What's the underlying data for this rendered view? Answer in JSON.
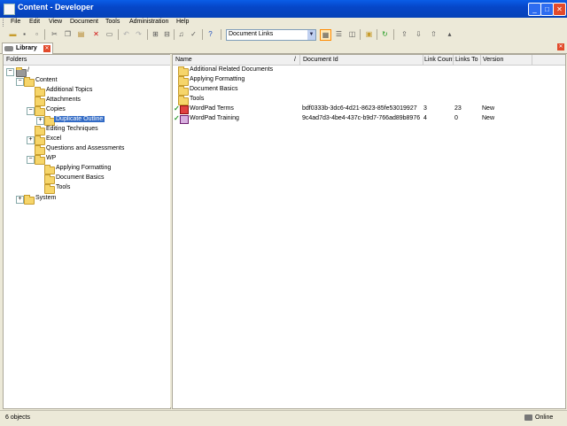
{
  "window": {
    "title": "Content - Developer"
  },
  "menu": [
    "File",
    "Edit",
    "View",
    "Document",
    "Tools",
    "Administration",
    "Help"
  ],
  "toolbar": {
    "links_combo_value": "Document Links"
  },
  "tab": {
    "label": "Library"
  },
  "folders_pane": {
    "header": "Folders",
    "tree": [
      {
        "label": "/",
        "expander": "−"
      },
      {
        "label": "Content",
        "expander": "−"
      },
      {
        "label": "Additional Topics"
      },
      {
        "label": "Attachments"
      },
      {
        "label": "Copies",
        "expander": "−"
      },
      {
        "label": "Duplicate Outline",
        "expander": "+",
        "selected": true
      },
      {
        "label": "Editing Techniques"
      },
      {
        "label": "Excel",
        "expander": "+"
      },
      {
        "label": "Questions and Assessments"
      },
      {
        "label": "WP",
        "expander": "−"
      },
      {
        "label": "Applying Formatting"
      },
      {
        "label": "Document Basics"
      },
      {
        "label": "Tools"
      },
      {
        "label": "System",
        "expander": "+"
      }
    ]
  },
  "list": {
    "columns": {
      "name": "Name",
      "sort": "/",
      "document_id": "Document Id",
      "link_count": "Link Count",
      "links_to": "Links To",
      "version": "Version"
    },
    "rows": [
      {
        "name": "Additional Related Documents",
        "document_id": "",
        "link_count": "",
        "links_to": "",
        "version": ""
      },
      {
        "name": "Applying Formatting",
        "document_id": "",
        "link_count": "",
        "links_to": "",
        "version": ""
      },
      {
        "name": "Document Basics",
        "document_id": "",
        "link_count": "",
        "links_to": "",
        "version": ""
      },
      {
        "name": "Tools",
        "document_id": "",
        "link_count": "",
        "links_to": "",
        "version": ""
      },
      {
        "name": "WordPad Terms",
        "document_id": "bdf0333b-3dc6-4d21-8623-85fe53019927",
        "link_count": "3",
        "links_to": "23",
        "version": "New"
      },
      {
        "name": "WordPad Training",
        "document_id": "9c4ad7d3-4be4-437c-b9d7-766ad89b8976",
        "link_count": "4",
        "links_to": "0",
        "version": "New"
      }
    ]
  },
  "status": {
    "count": "6 objects",
    "connection": "Online"
  }
}
